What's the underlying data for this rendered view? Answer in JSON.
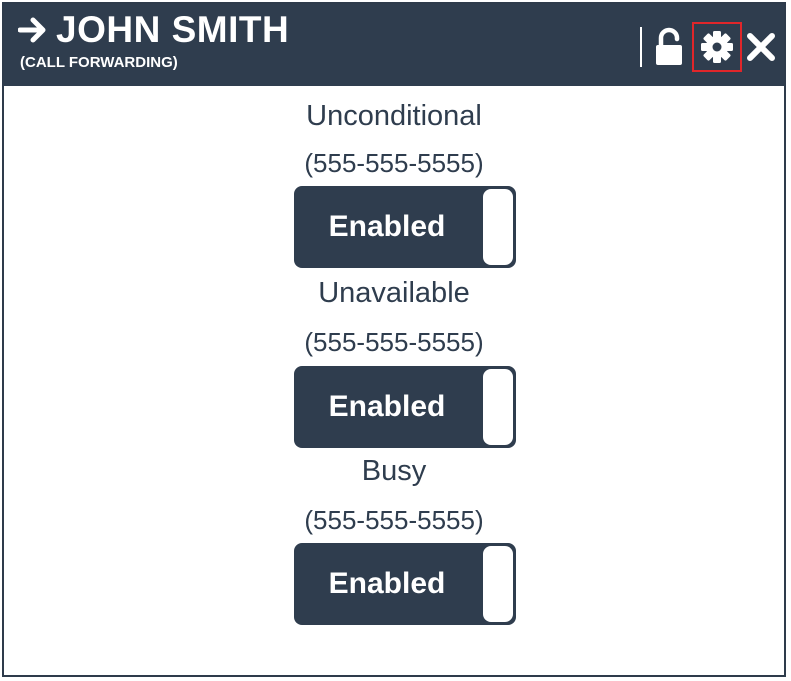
{
  "header": {
    "title": "JOHN SMITH",
    "subtitle": "(CALL FORWARDING)"
  },
  "icons": {
    "title_icon": "arrow-right-icon",
    "lock": "unlock-icon",
    "settings": "gear-icon",
    "close": "close-icon"
  },
  "colors": {
    "header_bg": "#2f3d4e",
    "highlight": "#e0262a",
    "text": "#2f3d4e",
    "toggle_text": "#ffffff"
  },
  "rules": [
    {
      "name": "Unconditional",
      "number": "(555-555-5555)",
      "state": "Enabled"
    },
    {
      "name": "Unavailable",
      "number": "(555-555-5555)",
      "state": "Enabled"
    },
    {
      "name": "Busy",
      "number": "(555-555-5555)",
      "state": "Enabled"
    }
  ]
}
